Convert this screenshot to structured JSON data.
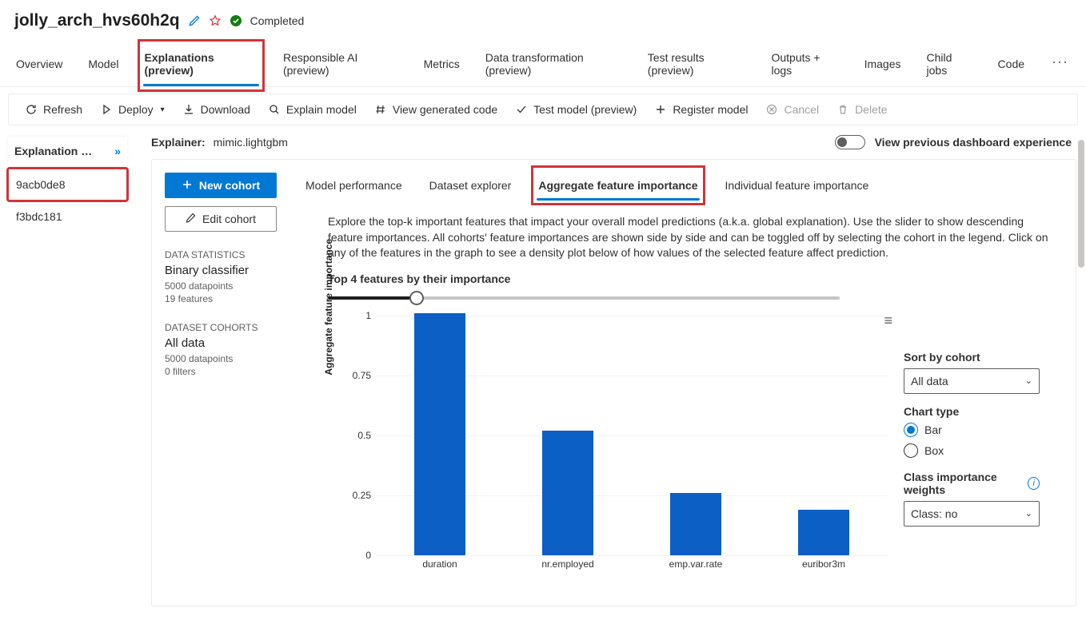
{
  "header": {
    "title": "jolly_arch_hvs60h2q",
    "status": "Completed"
  },
  "tabs": {
    "items": [
      "Overview",
      "Model",
      "Explanations (preview)",
      "Responsible AI (preview)",
      "Metrics",
      "Data transformation (preview)",
      "Test results (preview)",
      "Outputs + logs",
      "Images",
      "Child jobs",
      "Code"
    ],
    "active": 2
  },
  "toolbar": {
    "refresh": "Refresh",
    "deploy": "Deploy",
    "download": "Download",
    "explain": "Explain model",
    "view_code": "View generated code",
    "test_model": "Test model (preview)",
    "register": "Register model",
    "cancel": "Cancel",
    "delete": "Delete"
  },
  "sidebar": {
    "header": "Explanation …",
    "items": [
      "9acb0de8",
      "f3bdc181"
    ],
    "active": 0
  },
  "explainer": {
    "label": "Explainer:",
    "value": "mimic.lightgbm",
    "toggle_label": "View previous dashboard experience"
  },
  "cohort": {
    "new": "New cohort",
    "edit": "Edit cohort"
  },
  "stats": {
    "h1": "DATA STATISTICS",
    "v1": "Binary classifier",
    "s1a": "5000 datapoints",
    "s1b": "19 features",
    "h2": "DATASET COHORTS",
    "v2": "All data",
    "s2a": "5000 datapoints",
    "s2b": "0 filters"
  },
  "subtabs": {
    "items": [
      "Model performance",
      "Dataset explorer",
      "Aggregate feature importance",
      "Individual feature importance"
    ],
    "active": 2
  },
  "description": "Explore the top-k important features that impact your overall model predictions (a.k.a. global explanation). Use the slider to show descending feature importances. All cohorts' feature importances are shown side by side and can be toggled off by selecting the cohort in the legend. Click on any of the features in the graph to see a density plot below of how values of the selected feature affect prediction.",
  "slider": {
    "title": "Top 4 features by their importance"
  },
  "chart_data": {
    "type": "bar",
    "categories": [
      "duration",
      "nr.employed",
      "emp.var.rate",
      "euribor3m"
    ],
    "values": [
      1.01,
      0.52,
      0.26,
      0.19
    ],
    "ylabel": "Aggregate feature importance",
    "xlabel": "",
    "ylim": [
      0,
      1
    ],
    "yticks": [
      0,
      0.25,
      0.5,
      0.75,
      1
    ],
    "title": ""
  },
  "controls": {
    "sort_label": "Sort by cohort",
    "sort_value": "All data",
    "chart_type_label": "Chart type",
    "chart_type_options": [
      "Bar",
      "Box"
    ],
    "chart_type_selected": "Bar",
    "weights_label": "Class importance weights",
    "weights_value": "Class: no"
  }
}
